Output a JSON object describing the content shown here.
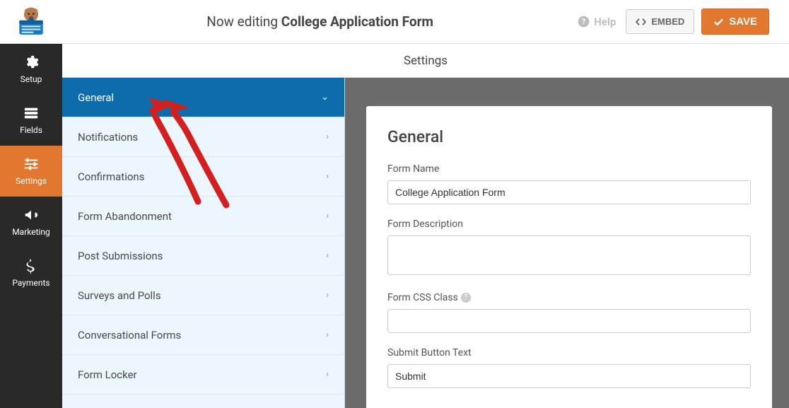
{
  "header": {
    "editing_prefix": "Now editing ",
    "form_title": "College Application Form",
    "help_label": "Help",
    "embed_label": "EMBED",
    "save_label": "SAVE"
  },
  "sidebar": {
    "items": [
      {
        "label": "Setup"
      },
      {
        "label": "Fields"
      },
      {
        "label": "Settings"
      },
      {
        "label": "Marketing"
      },
      {
        "label": "Payments"
      }
    ]
  },
  "section_title": "Settings",
  "settings_menu": {
    "items": [
      {
        "label": "General",
        "active": true
      },
      {
        "label": "Notifications"
      },
      {
        "label": "Confirmations"
      },
      {
        "label": "Form Abandonment"
      },
      {
        "label": "Post Submissions"
      },
      {
        "label": "Surveys and Polls"
      },
      {
        "label": "Conversational Forms"
      },
      {
        "label": "Form Locker"
      }
    ]
  },
  "panel": {
    "heading": "General",
    "fields": {
      "form_name": {
        "label": "Form Name",
        "value": "College Application Form"
      },
      "form_description": {
        "label": "Form Description",
        "value": ""
      },
      "form_css_class": {
        "label": "Form CSS Class",
        "value": ""
      },
      "submit_button_text": {
        "label": "Submit Button Text",
        "value": "Submit"
      }
    }
  },
  "colors": {
    "accent": "#e27730",
    "primary_blue": "#0e6cad"
  }
}
